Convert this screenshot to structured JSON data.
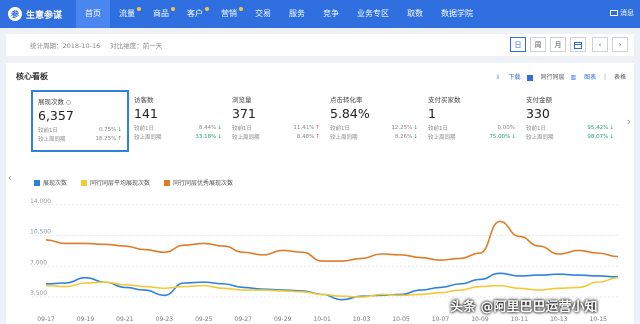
{
  "nav": {
    "brand": "生意参谋",
    "brand_logo": "参",
    "items": [
      {
        "label": "首页",
        "active": true,
        "dot": false
      },
      {
        "label": "流量",
        "dot": true
      },
      {
        "label": "商品",
        "dot": true
      },
      {
        "label": "客户",
        "dot": true
      },
      {
        "label": "营销",
        "dot": true
      },
      {
        "label": "交易",
        "dot": false
      },
      {
        "label": "服务",
        "dot": false
      },
      {
        "label": "竞争",
        "dot": false
      },
      {
        "label": "业务专区",
        "dot": false
      },
      {
        "label": "取数",
        "dot": false
      },
      {
        "label": "数据学院",
        "dot": false
      }
    ],
    "messages": "消息"
  },
  "datebar": {
    "period": "统计周期：2018-10-16",
    "compare": "对比维度：前一天",
    "buttons": [
      "日",
      "周",
      "月"
    ]
  },
  "panel": {
    "title": "核心看板",
    "download": "下载",
    "peer_checkbox": "同行同层",
    "chart_view": "图表",
    "table_view": "表格"
  },
  "cards": [
    {
      "label": "展现次数",
      "value": "6,357",
      "c1_label": "较前1日",
      "c1": "0.75%",
      "c1_dir": "down",
      "c2_label": "较上周同期",
      "c2": "18.25%",
      "c2_dir": "up",
      "selected": true,
      "info": true
    },
    {
      "label": "访客数",
      "value": "141",
      "c1_label": "较前1日",
      "c1": "8.44%",
      "c1_dir": "down",
      "c2_label": "较上周同期",
      "c2": "33.18%",
      "c2_dir": "down",
      "c2_green": true
    },
    {
      "label": "浏览量",
      "value": "371",
      "c1_label": "较前1日",
      "c1": "11.41%",
      "c1_dir": "up",
      "c2_label": "较上周同期",
      "c2": "8.48%",
      "c2_dir": "up"
    },
    {
      "label": "点击转化率",
      "value": "5.84%",
      "c1_label": "较前1日",
      "c1": "12.25%",
      "c1_dir": "down",
      "c2_label": "较上周同期",
      "c2": "8.26%",
      "c2_dir": "down"
    },
    {
      "label": "支付买家数",
      "value": "1",
      "c1_label": "较前1日",
      "c1": "0.00%",
      "c1_dir": "none",
      "c2_label": "较上周同期",
      "c2": "75.00%",
      "c2_dir": "down",
      "c2_green": true
    },
    {
      "label": "支付金额",
      "value": "330",
      "c1_label": "较前1日",
      "c1": "95.42%",
      "c1_dir": "down",
      "c1_green": true,
      "c2_label": "较上周同期",
      "c2": "98.07%",
      "c2_dir": "down",
      "c2_green": true
    }
  ],
  "chart_data": {
    "type": "line",
    "x": [
      "09-17",
      "09-18",
      "09-19",
      "09-20",
      "09-21",
      "09-22",
      "09-23",
      "09-24",
      "09-25",
      "09-26",
      "09-27",
      "09-28",
      "09-29",
      "09-30",
      "10-01",
      "10-02",
      "10-03",
      "10-04",
      "10-05",
      "10-06",
      "10-07",
      "10-08",
      "10-09",
      "10-10",
      "10-11",
      "10-12",
      "10-13",
      "10-14",
      "10-15",
      "10-16"
    ],
    "xticks": [
      "09-17",
      "09-19",
      "09-21",
      "09-23",
      "09-25",
      "09-27",
      "09-29",
      "10-01",
      "10-03",
      "10-05",
      "10-07",
      "10-09",
      "10-11",
      "10-13",
      "10-15"
    ],
    "yticks": [
      3500,
      7000,
      10500,
      14000
    ],
    "ylim": [
      1800,
      15000
    ],
    "series": [
      {
        "name": "展现次数",
        "color": "#2f83d6",
        "values": [
          5000,
          5100,
          5700,
          5200,
          4600,
          4300,
          3700,
          5100,
          5200,
          5000,
          4600,
          4400,
          4300,
          4200,
          3800,
          3200,
          3600,
          3700,
          3800,
          4300,
          4600,
          5000,
          5500,
          6200,
          5900,
          6000,
          6100,
          6000,
          5900,
          5800
        ]
      },
      {
        "name": "同行同层平均展现次数",
        "color": "#f3c938",
        "values": [
          4800,
          4700,
          5100,
          5200,
          4900,
          4700,
          4500,
          4700,
          4800,
          4500,
          4300,
          4300,
          4200,
          4100,
          3800,
          3600,
          3500,
          3800,
          3700,
          3800,
          4000,
          4300,
          4700,
          4800,
          4500,
          4300,
          4500,
          4600,
          5200,
          5700
        ]
      },
      {
        "name": "同行同层优秀展现次数",
        "color": "#e07b26",
        "values": [
          10000,
          9600,
          9600,
          9500,
          9300,
          8900,
          8600,
          9400,
          9600,
          9300,
          8600,
          8300,
          8800,
          8600,
          7600,
          7600,
          7900,
          8400,
          8300,
          8000,
          7700,
          7900,
          8500,
          12100,
          10400,
          9300,
          8400,
          8800,
          8500,
          8100
        ]
      }
    ]
  },
  "watermark": "头条 @阿里巴巴运营小知",
  "colors": {
    "nav": "#2f6fe0",
    "accent": "#2f83d6",
    "up": "#e04b4b",
    "down": "#23a96f"
  }
}
